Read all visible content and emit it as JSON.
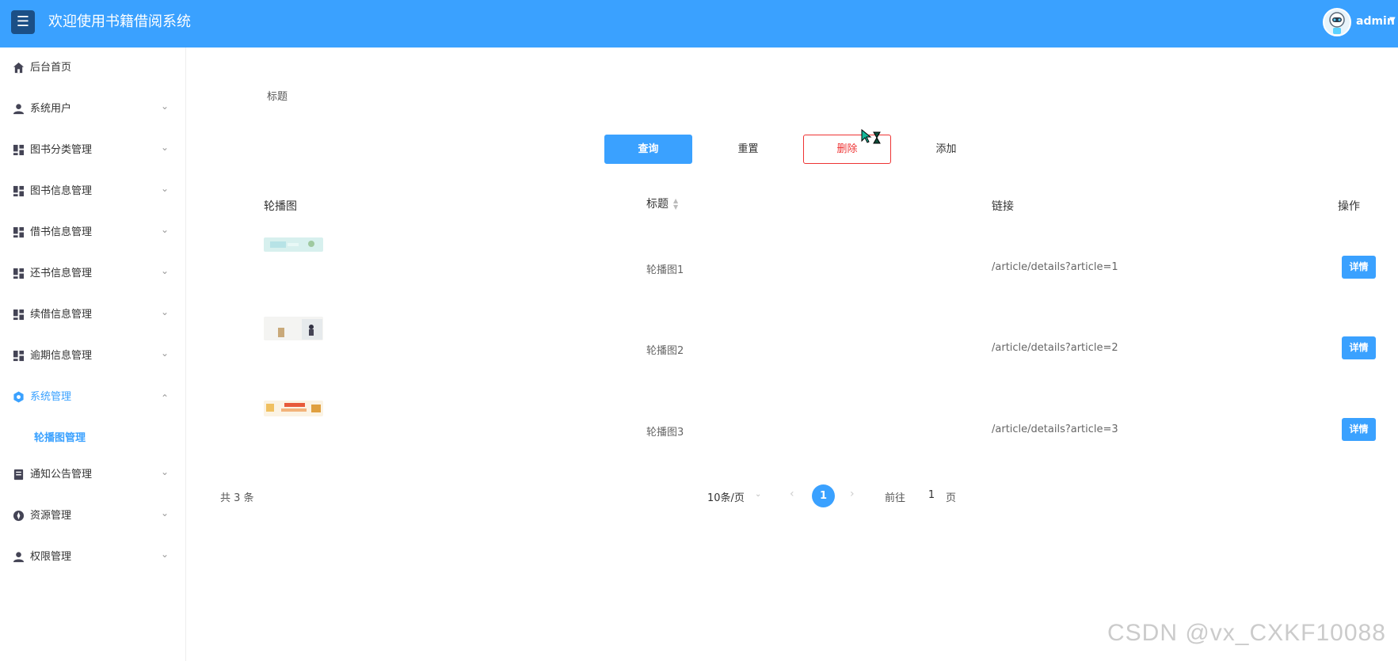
{
  "header": {
    "menu_icon": "hamburger-icon",
    "title": "欢迎使用书籍借阅系统",
    "user": "admin",
    "avatar_icon": "robot-avatar-icon"
  },
  "sidebar": {
    "items": [
      {
        "label": "后台首页",
        "icon": "home-icon"
      },
      {
        "label": "系统用户",
        "icon": "user-icon"
      },
      {
        "label": "图书分类管理",
        "icon": "grid-icon"
      },
      {
        "label": "图书信息管理",
        "icon": "grid-icon"
      },
      {
        "label": "借书信息管理",
        "icon": "grid-icon"
      },
      {
        "label": "还书信息管理",
        "icon": "grid-icon"
      },
      {
        "label": "续借信息管理",
        "icon": "grid-icon"
      },
      {
        "label": "逾期信息管理",
        "icon": "grid-icon"
      },
      {
        "label": "系统管理",
        "icon": "gear-icon"
      },
      {
        "label": "通知公告管理",
        "icon": "document-icon"
      },
      {
        "label": "资源管理",
        "icon": "compass-icon"
      },
      {
        "label": "权限管理",
        "icon": "user-icon"
      }
    ],
    "sub_active": "轮播图管理"
  },
  "filter": {
    "label": "标题"
  },
  "buttons": {
    "query": "查询",
    "reset": "重置",
    "delete": "删除",
    "add": "添加"
  },
  "table": {
    "headers": [
      "轮播图",
      "标题",
      "链接",
      "操作"
    ],
    "rows": [
      {
        "title": "轮播图1",
        "link": "/article/details?article=1",
        "action": "详情"
      },
      {
        "title": "轮播图2",
        "link": "/article/details?article=2",
        "action": "详情"
      },
      {
        "title": "轮播图3",
        "link": "/article/details?article=3",
        "action": "详情"
      }
    ]
  },
  "pagination": {
    "total": "共 3 条",
    "page_size": "10条/页",
    "current": "1",
    "goto_prefix": "前往",
    "goto_value": "1",
    "goto_suffix": "页"
  },
  "watermark": "CSDN @vx_CXKF10088",
  "colors": {
    "primary": "#3aa1ff",
    "danger": "#ee3333",
    "menu_toggle_bg": "#1b4f86"
  }
}
